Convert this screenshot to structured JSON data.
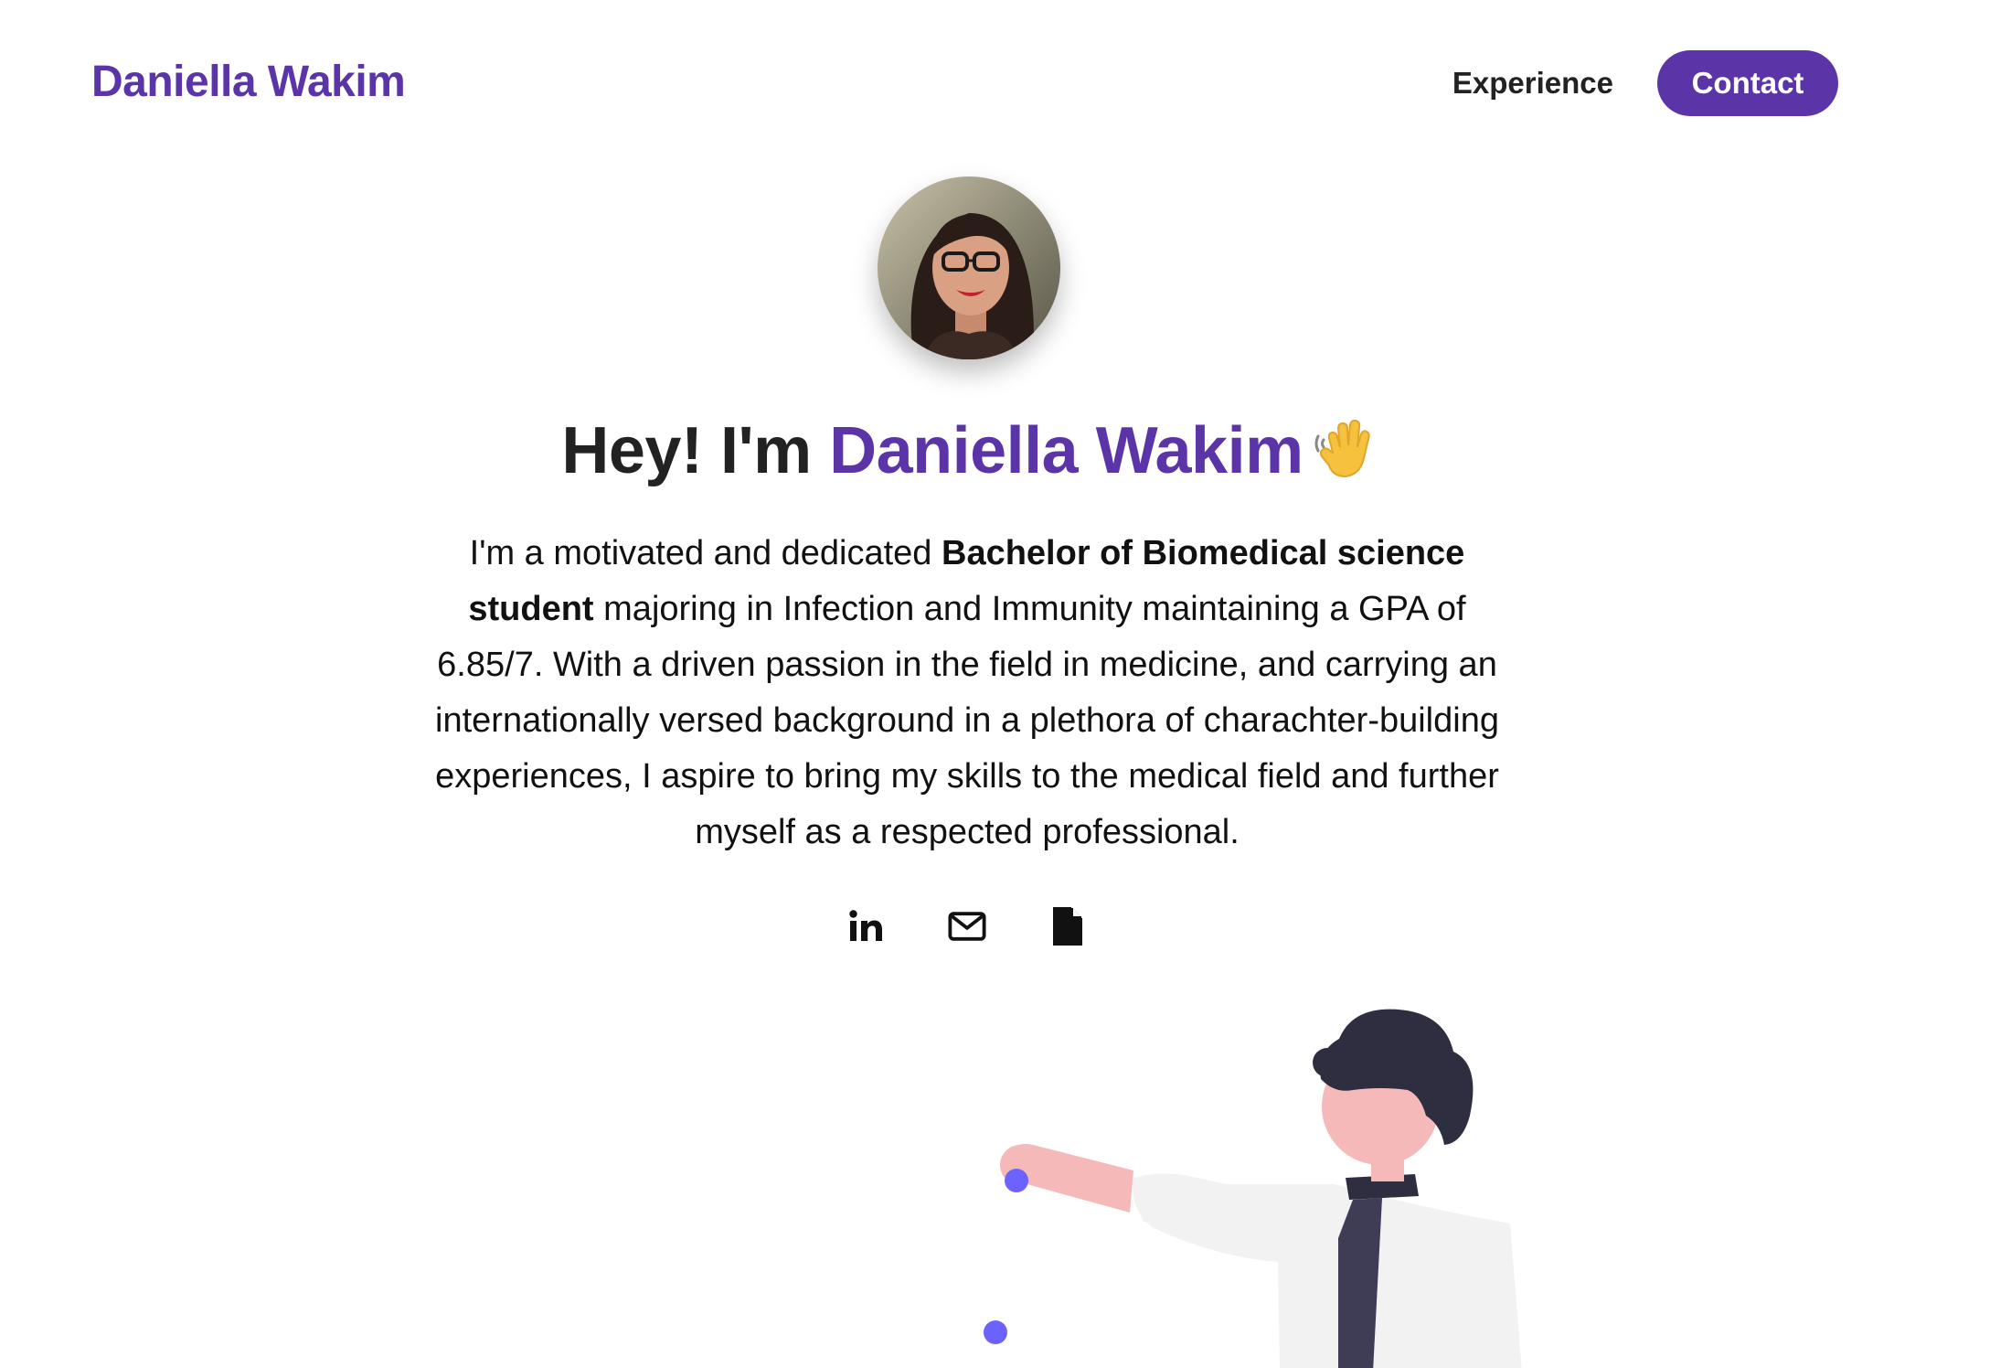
{
  "header": {
    "brand": "Daniella Wakim",
    "nav": {
      "experience": "Experience",
      "contact": "Contact"
    }
  },
  "hero": {
    "greeting": "Hey! I'm ",
    "name": "Daniella Wakim",
    "wave_emoji": "waving-hand-icon"
  },
  "bio": {
    "part1": "I'm a motivated and dedicated ",
    "bold": "Bachelor of Biomedical science student",
    "part2": " majoring in Infection and Immunity maintaining a GPA of 6.85/7. With a driven passion in the field in medicine, and carrying an internationally versed background in a plethora of charachter-building experiences, I aspire to bring my skills to the medical field and further myself as a respected professional."
  },
  "socials": [
    {
      "icon": "linkedin-icon"
    },
    {
      "icon": "email-icon"
    },
    {
      "icon": "document-icon"
    }
  ],
  "colors": {
    "accent": "#5b35a8",
    "illustration_dot": "#6c63ff",
    "skin": "#f4b9b8",
    "hair": "#2f2e41",
    "shirt": "#f2f2f2"
  }
}
